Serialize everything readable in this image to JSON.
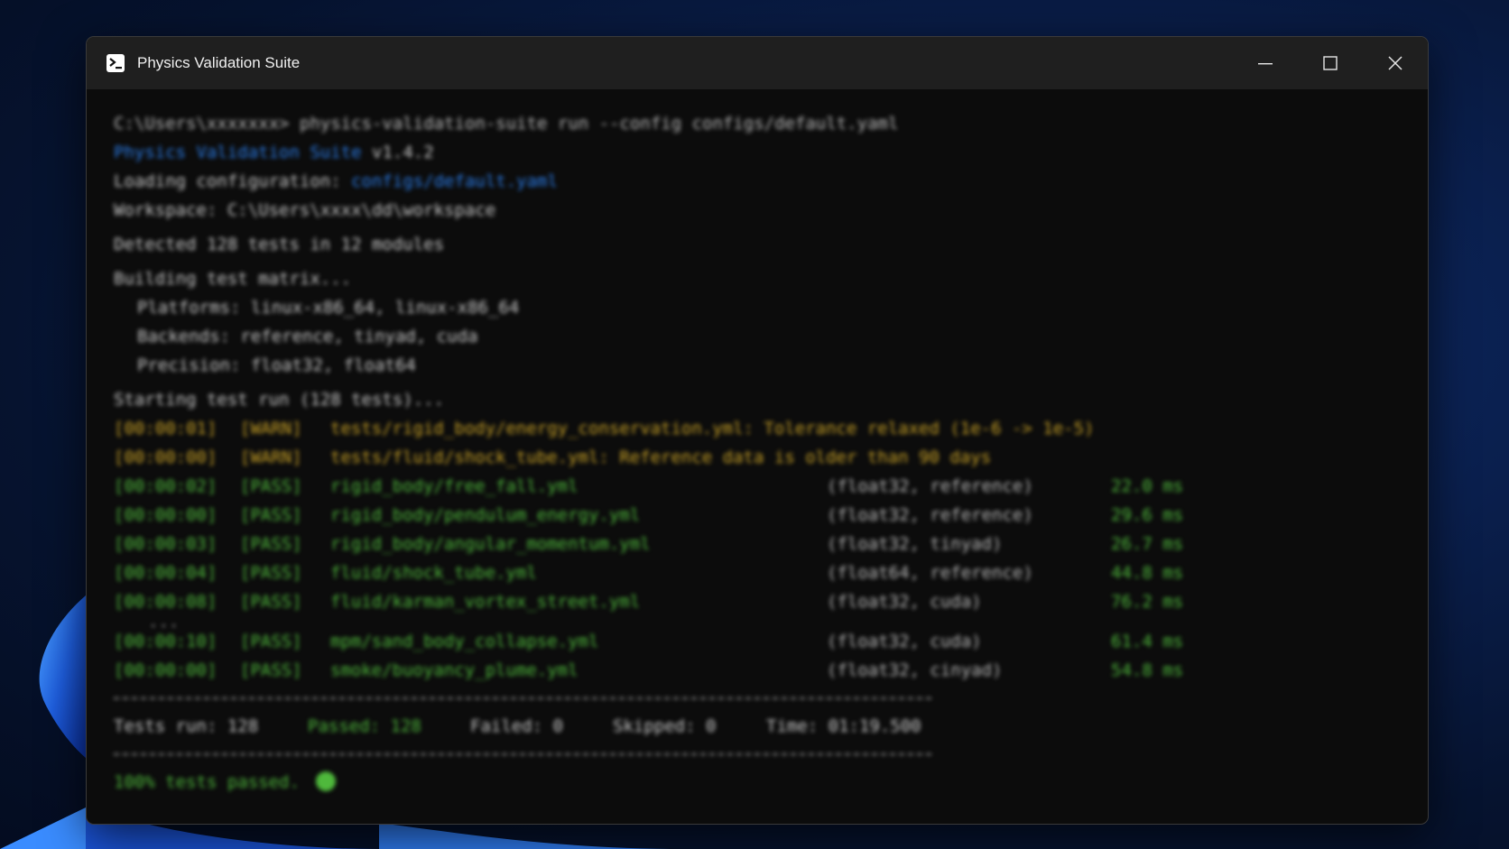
{
  "window": {
    "title": "Physics Validation Suite",
    "icon": "terminal-app-icon"
  },
  "controls": {
    "minimize": "minimize-icon",
    "maximize": "maximize-icon",
    "close": "close-icon"
  },
  "terminal": {
    "prompt": "C:\\Users\\",
    "prompt_user": "xxxxxxx",
    "prompt_suffix": "> ",
    "command": "physics-validation-suite run --config configs/default.yaml",
    "app_name": "Physics Validation Suite",
    "version": "v1.4.2",
    "loading_label": "Loading configuration: ",
    "loading_path": "configs/default.yaml",
    "workspace_line": "Workspace: C:\\Users\\xxxx\\dd\\workspace",
    "detected_line": "Detected 128 tests in 12 modules",
    "building_line": "Building test matrix...",
    "platforms_line": "Platforms: linux-x86_64, linux-x86_64",
    "backends_line": "Backends: reference, tinyad, cuda",
    "precision_line": "Precision: float32, float64",
    "starting_line": "Starting test run (128 tests)...",
    "warnings": [
      {
        "ts": "[00:00:01]",
        "tag": "[WARN]",
        "msg": "tests/rigid_body/energy_conservation.yml: Tolerance relaxed (1e-6 -> 1e-5)"
      },
      {
        "ts": "[00:00:00]",
        "tag": "[WARN]",
        "msg": "tests/fluid/shock_tube.yml: Reference data is older than 90 days"
      }
    ],
    "passes": [
      {
        "ts": "[00:00:02]",
        "tag": "[PASS]",
        "file": "rigid_body/free_fall.yml",
        "cfg": "(float32, reference)",
        "ms": "22.0 ms"
      },
      {
        "ts": "[00:00:00]",
        "tag": "[PASS]",
        "file": "rigid_body/pendulum_energy.yml",
        "cfg": "(float32, reference)",
        "ms": "29.6 ms"
      },
      {
        "ts": "[00:00:03]",
        "tag": "[PASS]",
        "file": "rigid_body/angular_momentum.yml",
        "cfg": "(float32, tinyad)",
        "ms": "26.7 ms"
      },
      {
        "ts": "[00:00:04]",
        "tag": "[PASS]",
        "file": "fluid/shock_tube.yml",
        "cfg": "(float64, reference)",
        "ms": "44.8 ms"
      },
      {
        "ts": "[00:00:08]",
        "tag": "[PASS]",
        "file": "fluid/karman_vortex_street.yml",
        "cfg": "(float32, cuda)",
        "ms": "76.2 ms"
      }
    ],
    "ellipsis": "...",
    "passes_tail": [
      {
        "ts": "[00:00:10]",
        "tag": "[PASS]",
        "file": "mpm/sand_body_collapse.yml",
        "cfg": "(float32, cuda)",
        "ms": "61.4 ms"
      },
      {
        "ts": "[00:00:00]",
        "tag": "[PASS]",
        "file": "smoke/buoyancy_plume.yml",
        "cfg": "(float32, cinyad)",
        "ms": "54.8 ms"
      }
    ],
    "summary": {
      "run": "Tests run: 128",
      "passed": "Passed: 128",
      "failed": "Failed: 0",
      "skipped": "Skipped: 0",
      "time": "Time: 01:19.500"
    },
    "final": "100% tests passed."
  },
  "colors": {
    "accent_blue": "#2b7de9",
    "warn": "#c9a227",
    "pass": "#4fb93c"
  }
}
